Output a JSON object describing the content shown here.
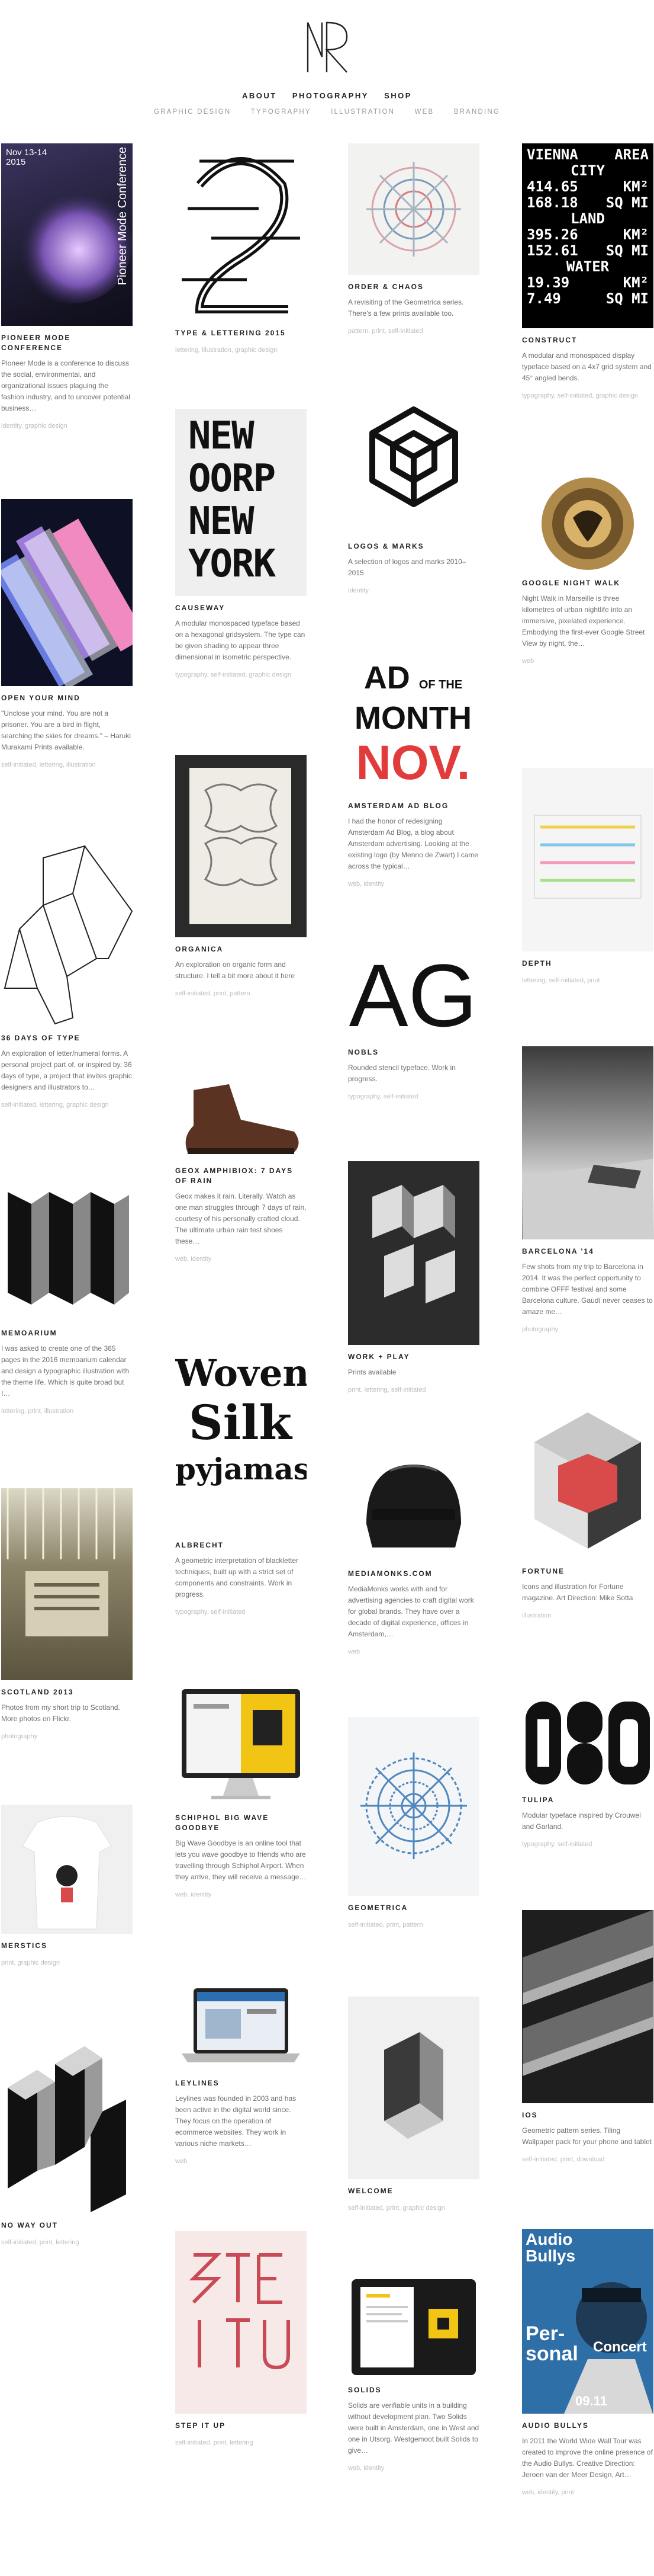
{
  "header": {
    "logo_letters": "NR",
    "nav_primary": [
      "ABOUT",
      "PHOTOGRAPHY",
      "SHOP"
    ],
    "nav_secondary": [
      "GRAPHIC DESIGN",
      "TYPOGRAPHY",
      "ILLUSTRATION",
      "WEB",
      "BRANDING"
    ]
  },
  "thumb_text": {
    "pioneer": [
      "Nov 13-14",
      "2015",
      "Pioneer Mode",
      "Conference"
    ],
    "vienna": [
      "VIENNA",
      "AREA",
      "CITY",
      "414.65",
      "KM²",
      "168.18",
      "SQ MI",
      "LAND",
      "395.26",
      "KM²",
      "152.61",
      "SQ MI",
      "WATER",
      "19.39",
      "KM²",
      "7.49",
      "SQ MI"
    ],
    "causeway": [
      "NEW",
      "OORP",
      "NEW",
      "YORK"
    ],
    "admonth": [
      "AD",
      "OF THE",
      "MONTH",
      "NOV."
    ],
    "nobls": "AG",
    "albrecht": [
      "Woven",
      "Silk",
      "pyjamas"
    ],
    "audio": [
      "Audio",
      "Bullys",
      "Per-",
      "sonal",
      "Concert",
      "09.11"
    ]
  },
  "items": [
    {
      "key": "pioneer",
      "title": "Pioneer Mode Conference",
      "desc": "Pioneer Mode is a conference to discuss the social, environmental, and organizational issues plaguing the fashion industry, and to uncover potential business…",
      "tags": "identity, graphic design"
    },
    {
      "key": "type2015",
      "title": "Type & Lettering 2015",
      "desc": "",
      "tags": "lettering, illustration, graphic design"
    },
    {
      "key": "order",
      "title": "Order & Chaos",
      "desc": "A revisiting of the Geometrica series. There's a few prints available too.",
      "tags": "pattern, print, self-initiated"
    },
    {
      "key": "construct",
      "title": "Construct",
      "desc": "A modular and monospaced display typeface based on a 4x7 grid system and 45° angled bends.",
      "tags": "typography, self-initiated, graphic design"
    },
    {
      "key": "causeway",
      "title": "Causeway",
      "desc": "A modular monospaced typeface based on a hexagonal gridsystem. The type can be given shading to appear three dimensional in isometric perspective.",
      "tags": "typography, self-initiated, graphic design"
    },
    {
      "key": "logos",
      "title": "Logos & Marks",
      "desc": "A selection of logos and marks 2010–2015",
      "tags": "identity"
    },
    {
      "key": "openmind",
      "title": "Open Your Mind",
      "desc": "\"Unclose your mind. You are not a prisoner. You are a bird in flight, searching the skies for dreams.\" – Haruki Murakami Prints available.",
      "tags": "self-initiated, lettering, illustration"
    },
    {
      "key": "googlewalk",
      "title": "Google Night Walk",
      "desc": "Night Walk in Marseille is three kilometres of urban nightlife into an immersive, pixelated experience. Embodying the first-ever Google Street View by night, the…",
      "tags": "web"
    },
    {
      "key": "admonth",
      "title": "Amsterdam Ad Blog",
      "desc": "I had the honor of redesigning Amsterdam Ad Blog, a blog about Amsterdam advertising. Looking at the existing logo (by Menno de Zwart) I came across the typical…",
      "tags": "web, identity"
    },
    {
      "key": "organica",
      "title": "Organica",
      "desc": "An exploration on organic form and structure. I tell a bit more about it here",
      "tags": "self-initiated, print, pattern"
    },
    {
      "key": "depth",
      "title": "Depth",
      "desc": "",
      "tags": "lettering, self-initiated, print"
    },
    {
      "key": "days36",
      "title": "36 Days of Type",
      "desc": "An exploration of letter/numeral forms. A personal project part of, or inspired by, 36 days of type, a project that invites graphic designers and illustrators to…",
      "tags": "self-initiated, lettering, graphic design"
    },
    {
      "key": "nobls",
      "title": "Nobls",
      "desc": "Rounded stencil typeface. Work in progress.",
      "tags": "typography, self-initiated"
    },
    {
      "key": "geox",
      "title": "Geox Amphibiox: 7 Days of Rain",
      "desc": "Geox makes it rain. Literally. Watch as one man struggles through 7 days of rain, courtesy of his personally crafted cloud. The ultimate urban rain test shoes these…",
      "tags": "web, identity"
    },
    {
      "key": "barcelona",
      "title": "Barcelona '14",
      "desc": "Few shots from my trip to Barcelona in 2014. It was the perfect opportunity to combine OFFF festival and some Barcelona culture. Gaudí never ceases to amaze me…",
      "tags": "photography"
    },
    {
      "key": "memoarium",
      "title": "Memoarium",
      "desc": "I was asked to create one of the 365 pages in the 2016 memoarium calendar and design a typographic illustration with the theme life. Which is quite broad but I…",
      "tags": "lettering, print, illustration"
    },
    {
      "key": "workplay",
      "title": "Work + Play",
      "desc": "Prints available",
      "tags": "print, lettering, self-initiated"
    },
    {
      "key": "albrecht",
      "title": "Albrecht",
      "desc": "A geometric interpretation of blackletter techniques, built up with a strict set of components and constraints. Work in progress.",
      "tags": "typography, self-initiated"
    },
    {
      "key": "mediamonks",
      "title": "MediaMonks.com",
      "desc": "MediaMonks works with and for advertising agencies to craft digital work for global brands. They have over a decade of digital experience, offices in Amsterdam,…",
      "tags": "web"
    },
    {
      "key": "fortune",
      "title": "Fortune",
      "desc": "Icons and illustration for Fortune magazine. Art Direction: Mike Sotta",
      "tags": "illustration"
    },
    {
      "key": "scotland",
      "title": "Scotland 2013",
      "desc": "Photos from my short trip to Scotland. More photos on Flickr.",
      "tags": "photography"
    },
    {
      "key": "schiphol",
      "title": "Schiphol Big Wave Goodbye",
      "desc": "Big Wave Goodbye is an online tool that lets you wave goodbye to friends who are travelling through Schiphol Airport. When they arrive, they will receive a message…",
      "tags": "web, identity"
    },
    {
      "key": "tulipa",
      "title": "Tulipa",
      "desc": "Modular typeface inspired by Crouwel and Garland.",
      "tags": "typography, self-initiated"
    },
    {
      "key": "geometrica",
      "title": "Geometrica",
      "desc": "",
      "tags": "self-initiated, print, pattern"
    },
    {
      "key": "merstics",
      "title": "Merstics",
      "desc": "",
      "tags": "print, graphic design"
    },
    {
      "key": "leylines",
      "title": "Leylines",
      "desc": "Leylines was founded in 2003 and has been active in the digital world since. They focus on the operation of ecommerce websites. They work in various niche markets…",
      "tags": "web"
    },
    {
      "key": "ios",
      "title": "iOS",
      "desc": "Geometric pattern series. Tiling Wallpaper pack for your phone and tablet",
      "tags": "self-initiated, print, download"
    },
    {
      "key": "noway",
      "title": "No Way Out",
      "desc": "",
      "tags": "self-initiated, print, lettering"
    },
    {
      "key": "welcome",
      "title": "Welcome",
      "desc": "",
      "tags": "self-initiated, print, graphic design"
    },
    {
      "key": "stepitup",
      "title": "Step It Up",
      "desc": "",
      "tags": "self-initiated, print, lettering"
    },
    {
      "key": "solids",
      "title": "Solids",
      "desc": "Solids are verifiable units in a building without development plan. Two Solids were built in Amsterdam, one in West and one in Utsorg. Westgemoot built Solids to give…",
      "tags": "web, identity"
    },
    {
      "key": "audio",
      "title": "Audio Bullys",
      "desc": "In 2011 the World Wide Wall Tour was created to improve the online presence of the Audio Bullys. Creative Direction: Jeroen van der Meer Design, Art…",
      "tags": "web, identity, print"
    }
  ]
}
